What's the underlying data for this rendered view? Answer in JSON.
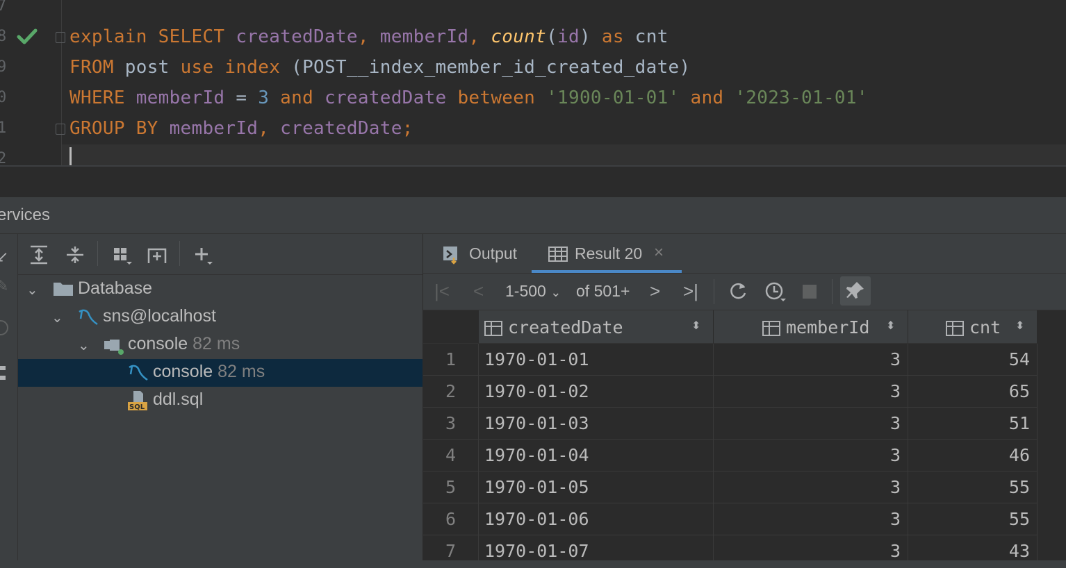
{
  "editor": {
    "line_numbers": [
      "7",
      "8",
      "9",
      "0",
      "1",
      "2"
    ],
    "lines": [
      [
        {
          "t": "explain ",
          "c": "kw"
        },
        {
          "t": "SELECT ",
          "c": "kw"
        },
        {
          "t": "createdDate",
          "c": "id"
        },
        {
          "t": ", ",
          "c": "kw"
        },
        {
          "t": "memberId",
          "c": "id"
        },
        {
          "t": ", ",
          "c": "kw"
        },
        {
          "t": "count",
          "c": "fn"
        },
        {
          "t": "(",
          "c": "plain"
        },
        {
          "t": "id",
          "c": "id"
        },
        {
          "t": ") ",
          "c": "plain"
        },
        {
          "t": "as ",
          "c": "kw"
        },
        {
          "t": "cnt",
          "c": "plain"
        }
      ],
      [
        {
          "t": "FROM ",
          "c": "kw"
        },
        {
          "t": "post ",
          "c": "plain"
        },
        {
          "t": "use ",
          "c": "kw"
        },
        {
          "t": "index ",
          "c": "kw"
        },
        {
          "t": "(POST__index_member_id_created_date)",
          "c": "plain"
        }
      ],
      [
        {
          "t": "WHERE ",
          "c": "kw"
        },
        {
          "t": "memberId ",
          "c": "id"
        },
        {
          "t": "= ",
          "c": "plain"
        },
        {
          "t": "3 ",
          "c": "num"
        },
        {
          "t": "and ",
          "c": "kw"
        },
        {
          "t": "createdDate ",
          "c": "id"
        },
        {
          "t": "between ",
          "c": "kw"
        },
        {
          "t": "'1900-01-01' ",
          "c": "str"
        },
        {
          "t": "and ",
          "c": "kw"
        },
        {
          "t": "'2023-01-01'",
          "c": "str"
        }
      ],
      [
        {
          "t": "GROUP BY ",
          "c": "kw"
        },
        {
          "t": "memberId",
          "c": "id"
        },
        {
          "t": ", ",
          "c": "kw"
        },
        {
          "t": "createdDate",
          "c": "id"
        },
        {
          "t": ";",
          "c": "kw"
        }
      ]
    ]
  },
  "services": {
    "title": "ervices",
    "tree": {
      "database_label": "Database",
      "host_label": "sns@localhost",
      "console_label": "console",
      "console_time": "82 ms",
      "session_label": "console",
      "session_time": "82 ms",
      "ddl_label": "ddl.sql"
    }
  },
  "result": {
    "tabs": [
      {
        "label": "Output",
        "icon": "output-icon"
      },
      {
        "label": "Result 20",
        "icon": "table-icon",
        "active": true
      }
    ],
    "pagination": {
      "range": "1-500",
      "total": "of 501+"
    },
    "columns": [
      "createdDate",
      "memberId",
      "cnt"
    ],
    "rows": [
      {
        "n": "1",
        "createdDate": "1970-01-01",
        "memberId": "3",
        "cnt": "54"
      },
      {
        "n": "2",
        "createdDate": "1970-01-02",
        "memberId": "3",
        "cnt": "65"
      },
      {
        "n": "3",
        "createdDate": "1970-01-03",
        "memberId": "3",
        "cnt": "51"
      },
      {
        "n": "4",
        "createdDate": "1970-01-04",
        "memberId": "3",
        "cnt": "46"
      },
      {
        "n": "5",
        "createdDate": "1970-01-05",
        "memberId": "3",
        "cnt": "55"
      },
      {
        "n": "6",
        "createdDate": "1970-01-06",
        "memberId": "3",
        "cnt": "55"
      },
      {
        "n": "7",
        "createdDate": "1970-01-07",
        "memberId": "3",
        "cnt": "43"
      }
    ]
  },
  "colors": {
    "keyword": "#cc7832",
    "identifier": "#9876aa",
    "function": "#ffc66d",
    "number": "#6897bb",
    "string": "#6a8759",
    "selection": "#0d293e",
    "tab_accent": "#4a88c7",
    "check": "#59a869"
  }
}
